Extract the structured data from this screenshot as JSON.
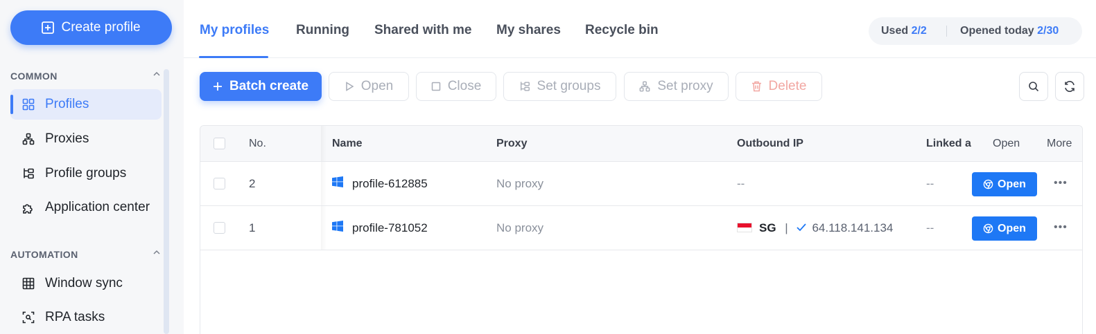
{
  "sidebar": {
    "create_label": "Create profile",
    "sections": [
      {
        "title": "COMMON",
        "items": [
          {
            "label": "Profiles",
            "icon": "grid-icon",
            "active": true
          },
          {
            "label": "Proxies",
            "icon": "network-icon"
          },
          {
            "label": "Profile groups",
            "icon": "tree-icon"
          },
          {
            "label": "Application center",
            "icon": "puzzle-icon"
          }
        ]
      },
      {
        "title": "AUTOMATION",
        "items": [
          {
            "label": "Window sync",
            "icon": "table-grid-icon"
          },
          {
            "label": "RPA tasks",
            "icon": "scan-icon"
          }
        ]
      }
    ]
  },
  "tabs": [
    "My profiles",
    "Running",
    "Shared with me",
    "My shares",
    "Recycle bin"
  ],
  "stats": {
    "used_label": "Used",
    "used_value": "2/2",
    "opened_label": "Opened today",
    "opened_value": "2/30"
  },
  "toolbar": {
    "batch_create": "Batch create",
    "open": "Open",
    "close": "Close",
    "set_groups": "Set groups",
    "set_proxy": "Set proxy",
    "delete": "Delete"
  },
  "table": {
    "headers": {
      "no": "No.",
      "name": "Name",
      "proxy": "Proxy",
      "outbound_ip": "Outbound IP",
      "linked": "Linked a",
      "open": "Open",
      "more": "More"
    },
    "rows": [
      {
        "no": "2",
        "name": "profile-612885",
        "proxy": "No proxy",
        "ip": "--",
        "linked": "--",
        "open_label": "Open"
      },
      {
        "no": "1",
        "name": "profile-781052",
        "proxy": "No proxy",
        "country": "SG",
        "ip_sep": "|",
        "ip": "64.118.141.134",
        "linked": "--",
        "open_label": "Open"
      }
    ]
  },
  "colors": {
    "accent": "#3d7bf7",
    "danger": "#f2a7a2"
  }
}
